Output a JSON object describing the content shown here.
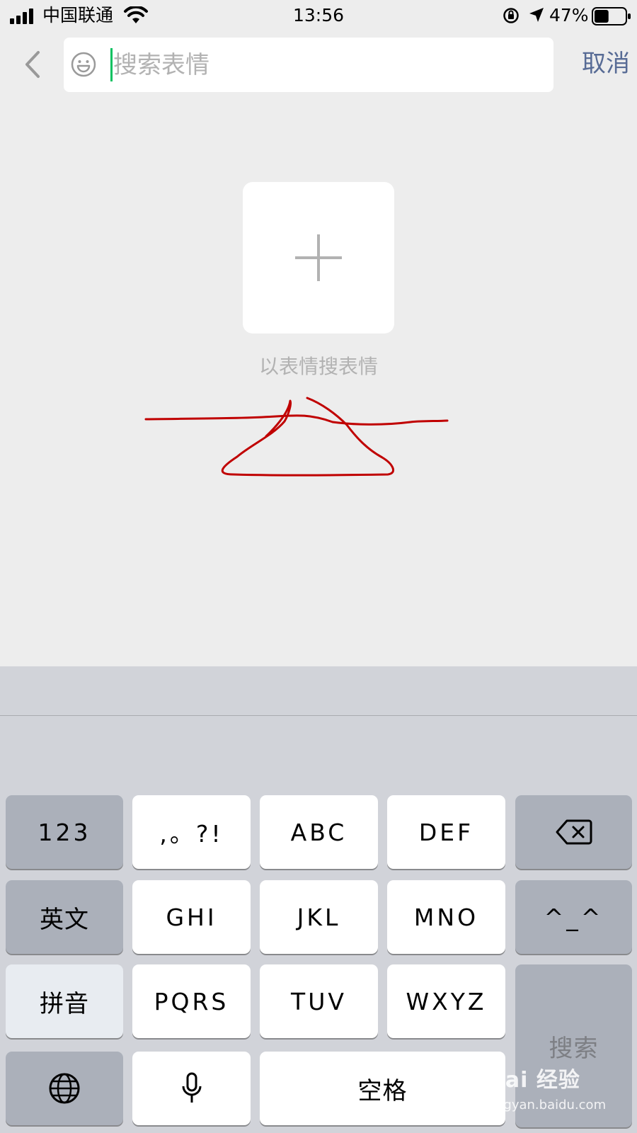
{
  "status_bar": {
    "carrier": "中国联通",
    "time": "13:56",
    "battery_percent": "47%",
    "battery_level": 0.47,
    "icons": [
      "signal-icon",
      "wifi-icon",
      "rotation-lock-icon",
      "location-icon",
      "battery-icon"
    ]
  },
  "header": {
    "back_icon": "chevron-left-icon",
    "search_placeholder": "搜索表情",
    "search_value": "",
    "emoji_icon": "smiley-icon",
    "cancel_label": "取消",
    "accent_color": "#576b95",
    "caret_color": "#07c160"
  },
  "main": {
    "add_icon": "plus-icon",
    "caption": "以表情搜表情"
  },
  "keyboard": {
    "rows": [
      [
        "123",
        ",。?!",
        "ABC",
        "DEF",
        "delete"
      ],
      [
        "英文",
        "GHI",
        "JKL",
        "MNO",
        "^_^"
      ],
      [
        "拼音",
        "PQRS",
        "TUV",
        "WXYZ",
        "搜索"
      ],
      [
        "globe",
        "mic",
        "空格"
      ]
    ],
    "key_123": "123",
    "key_punct": ",。?!",
    "key_abc": "ABC",
    "key_def": "DEF",
    "key_english": "英文",
    "key_ghi": "GHI",
    "key_jkl": "JKL",
    "key_mno": "MNO",
    "key_emoticon": "^_^",
    "key_pinyin": "拼音",
    "key_pqrs": "PQRS",
    "key_tuv": "TUV",
    "key_wxyz": "WXYZ",
    "key_search": "搜索",
    "key_space": "空格",
    "delete_icon": "backspace-icon",
    "globe_icon": "globe-icon",
    "mic_icon": "microphone-icon"
  },
  "annotation": {
    "description_icon": "red-hand-drawn-mark",
    "color": "#c00000"
  },
  "watermark": {
    "logo": "Bai 经验",
    "url": "jingyan.baidu.com"
  }
}
